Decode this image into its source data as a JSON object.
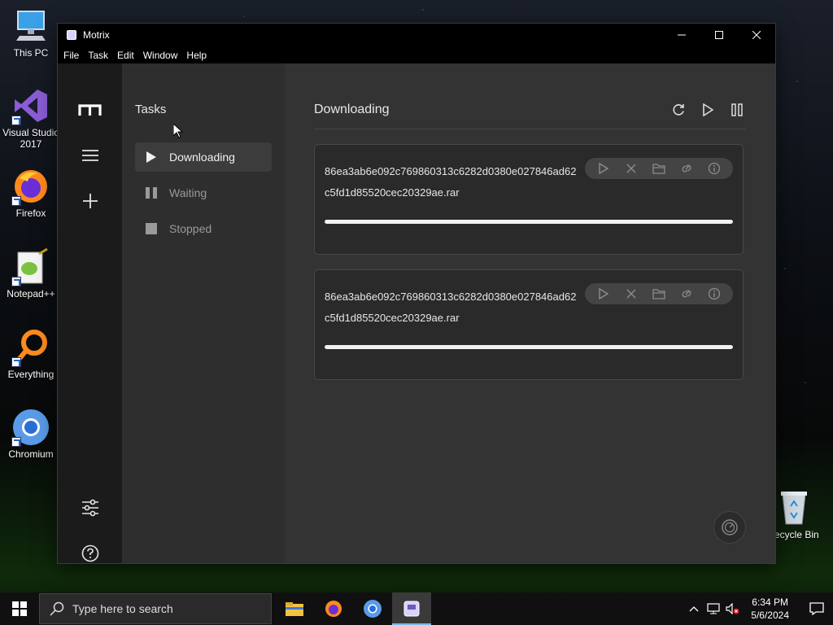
{
  "desktop": {
    "icons": [
      {
        "label": "This PC"
      },
      {
        "label": "Visual Studio 2017"
      },
      {
        "label": "Firefox"
      },
      {
        "label": "Notepad++"
      },
      {
        "label": "Everything"
      },
      {
        "label": "Chromium"
      },
      {
        "label": "ecycle Bin"
      }
    ]
  },
  "window": {
    "title": "Motrix",
    "menu": [
      "File",
      "Task",
      "Edit",
      "Window",
      "Help"
    ]
  },
  "sidebar": {
    "title": "Tasks",
    "items": [
      {
        "label": "Downloading",
        "icon": "play-icon"
      },
      {
        "label": "Waiting",
        "icon": "pause-icon"
      },
      {
        "label": "Stopped",
        "icon": "stop-icon"
      }
    ]
  },
  "main": {
    "heading": "Downloading",
    "tasks": [
      {
        "name": "86ea3ab6e092c769860313c6282d0380e027846ad62c5fd1d85520cec20329ae.rar",
        "progress": 1.0
      },
      {
        "name": "86ea3ab6e092c769860313c6282d0380e027846ad62c5fd1d85520cec20329ae.rar",
        "progress": 1.0
      }
    ]
  },
  "taskbar": {
    "search_placeholder": "Type here to search",
    "time": "6:34 PM",
    "date": "5/6/2024"
  },
  "colors": {
    "accent": "#76b9ed",
    "progress": "#f2f2f2",
    "rail": "#1b1b1b",
    "sidebar": "#2e2e2e",
    "main": "#333333"
  }
}
